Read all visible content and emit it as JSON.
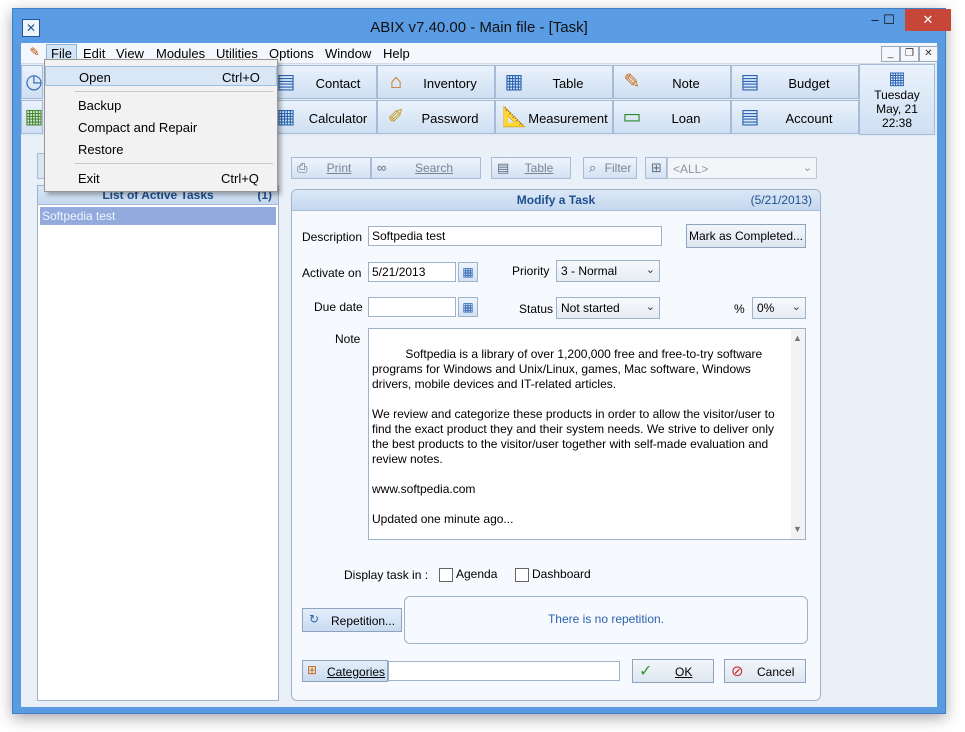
{
  "window": {
    "title": "ABIX v7.40.00  -  Main file - [Task]",
    "min": "–",
    "max": "☐",
    "close": "✕"
  },
  "menu": {
    "items": [
      "File",
      "Edit",
      "View",
      "Modules",
      "Utilities",
      "Options",
      "Window",
      "Help"
    ],
    "mdi": {
      "min": "_",
      "restore": "❐",
      "close": "✕"
    }
  },
  "file_menu": {
    "open": {
      "label": "Open",
      "shortcut": "Ctrl+O"
    },
    "backup": "Backup",
    "compact": "Compact and Repair",
    "restore": "Restore",
    "exit": {
      "label": "Exit",
      "shortcut": "Ctrl+Q"
    }
  },
  "toolbar": {
    "row1": [
      "Contact",
      "Inventory",
      "Table",
      "Note",
      "Budget"
    ],
    "row2": [
      "Calculator",
      "Password",
      "Measurement",
      "Loan",
      "Account"
    ],
    "date": {
      "day": "Tuesday",
      "date": "May, 21",
      "time": "22:38"
    }
  },
  "left_panel": {
    "title": "List of Active Tasks",
    "count": "(1)",
    "items": [
      "Softpedia test"
    ]
  },
  "right_toolbar": {
    "print": "Print",
    "search": "Search",
    "table": "Table",
    "filter": "Filter",
    "category_filter": "<ALL>"
  },
  "form": {
    "title": "Modify a Task",
    "date": "(5/21/2013)",
    "description_label": "Description",
    "description_value": "Softpedia test",
    "mark_completed": "Mark as Completed...",
    "activate_label": "Activate on",
    "activate_value": "5/21/2013",
    "priority_label": "Priority",
    "priority_value": "3 - Normal",
    "due_label": "Due date",
    "due_value": "",
    "status_label": "Status",
    "status_value": "Not started",
    "percent_label": "%",
    "percent_value": "0%",
    "note_label": "Note",
    "note_value": "Softpedia is a library of over 1,200,000 free and free-to-try software programs for Windows and Unix/Linux, games, Mac software, Windows drivers, mobile devices and IT-related articles.\n\nWe review and categorize these products in order to allow the visitor/user to find the exact product they and their system needs. We strive to deliver only the best products to the visitor/user together with self-made evaluation and review notes.\n\nwww.softpedia.com\n\nUpdated one minute ago...",
    "display_label": "Display task in :",
    "agenda": "Agenda",
    "dashboard": "Dashboard",
    "repetition_btn": "Repetition...",
    "repetition_text": "There is no repetition.",
    "categories_btn": "Categories",
    "categories_value": "",
    "ok": "OK",
    "cancel": "Cancel"
  }
}
